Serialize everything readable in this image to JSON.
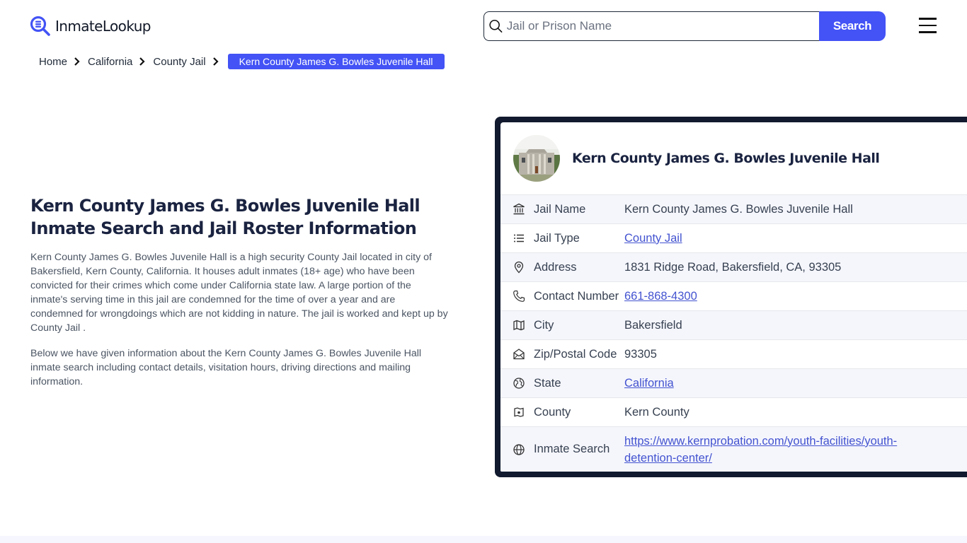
{
  "header": {
    "logo_text": "InmateLookup",
    "logo_icon": "magnifier-database-icon",
    "search": {
      "placeholder": "Jail or Prison Name",
      "value": "",
      "button_label": "Search"
    },
    "menu_icon": "hamburger-icon"
  },
  "breadcrumb": {
    "items": [
      {
        "label": "Home"
      },
      {
        "label": "California"
      },
      {
        "label": "County Jail"
      }
    ],
    "current": "Kern County James G. Bowles Juvenile Hall"
  },
  "main": {
    "title": "Kern County James G. Bowles Juvenile Hall Inmate Search and Jail Roster Information",
    "paragraphs": [
      "Kern County James G. Bowles Juvenile Hall is a high security County Jail located in city of Bakersfield, Kern County, California. It houses adult inmates (18+ age) who have been convicted for their crimes which come under California state law. A large portion of the inmate's serving time in this jail are condemned for the time of over a year and are condemned for wrongdoings which are not kidding in nature. The jail is worked and kept up by County Jail .",
      "Below we have given information about the Kern County James G. Bowles Juvenile Hall inmate search including contact details, visitation hours, driving directions and mailing information."
    ]
  },
  "card": {
    "title": "Kern County James G. Bowles Juvenile Hall",
    "image_alt": "facility-photo",
    "rows": [
      {
        "icon": "bank-building-icon",
        "label": "Jail Name",
        "value": "Kern County James G. Bowles Juvenile Hall",
        "link": false
      },
      {
        "icon": "list-icon",
        "label": "Jail Type",
        "value": "County Jail",
        "link": true
      },
      {
        "icon": "map-pin-icon",
        "label": "Address",
        "value": "1831 Ridge Road, Bakersfield, CA, 93305",
        "link": false
      },
      {
        "icon": "phone-icon",
        "label": "Contact Number",
        "value": "661-868-4300",
        "link": true
      },
      {
        "icon": "map-icon",
        "label": "City",
        "value": "Bakersfield",
        "link": false
      },
      {
        "icon": "mail-open-icon",
        "label": "Zip/Postal Code",
        "value": "93305",
        "link": false
      },
      {
        "icon": "globe-region-icon",
        "label": "State",
        "value": "California",
        "link": true
      },
      {
        "icon": "county-map-icon",
        "label": "County",
        "value": "Kern County",
        "link": false
      },
      {
        "icon": "globe-icon",
        "label": "Inmate Search",
        "value": "https://www.kernprobation.com/youth-facilities/youth-detention-center/",
        "link": true
      }
    ]
  },
  "colors": {
    "accent": "#4353f5",
    "link": "#4353d0",
    "heading": "#1a2340",
    "card_border": "#111a2e",
    "row_alt": "#f5f6fc"
  }
}
